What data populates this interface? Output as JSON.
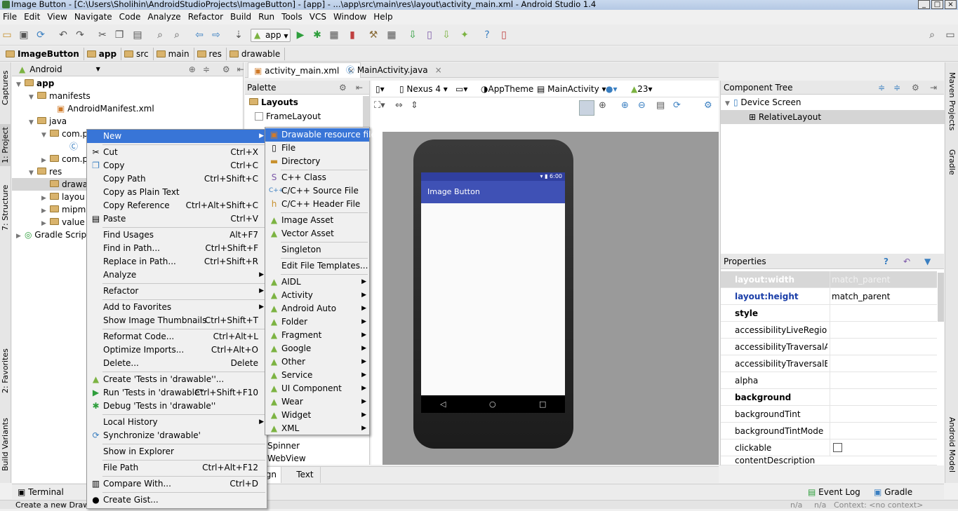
{
  "title": "Image Button - [C:\\Users\\Sholihin\\AndroidStudioProjects\\ImageButton] - [app] - ...\\app\\src\\main\\res\\layout\\activity_main.xml - Android Studio 1.4",
  "menubar": [
    "File",
    "Edit",
    "View",
    "Navigate",
    "Code",
    "Analyze",
    "Refactor",
    "Build",
    "Run",
    "Tools",
    "VCS",
    "Window",
    "Help"
  ],
  "toolbar": {
    "run_config": "app"
  },
  "breadcrumbs": [
    "ImageButton",
    "app",
    "src",
    "main",
    "res",
    "drawable"
  ],
  "left_tabs": [
    "1: Project",
    "7: Structure",
    "Captures",
    "2: Favorites",
    "Build Variants"
  ],
  "right_tabs": [
    "Maven Projects",
    "Gradle",
    "Android Model"
  ],
  "project": {
    "view": "Android",
    "tree": [
      "app",
      "manifests",
      "AndroidManifest.xml",
      "java",
      "com.p",
      "com.p",
      "res",
      "drawa",
      "layou",
      "mipma",
      "value",
      "Gradle Scripts"
    ]
  },
  "editor_tabs": [
    "activity_main.xml",
    "MainActivity.java"
  ],
  "palette": {
    "title": "Palette",
    "section": "Layouts",
    "items": [
      "FrameLayout",
      "Spinner",
      "WebView"
    ]
  },
  "design_toolbar": {
    "device": "Nexus 4",
    "theme": "AppTheme",
    "activity": "MainActivity",
    "api": "23"
  },
  "device": {
    "time": "6:00",
    "app_title": "Image Button"
  },
  "design_tabs": [
    "Design",
    "Text"
  ],
  "component_tree": {
    "title": "Component Tree",
    "items": [
      "Device Screen",
      "RelativeLayout"
    ]
  },
  "properties": {
    "title": "Properties",
    "rows": [
      {
        "k": "layout:width",
        "v": "match_parent"
      },
      {
        "k": "layout:height",
        "v": "match_parent"
      },
      {
        "k": "style",
        "v": ""
      },
      {
        "k": "accessibilityLiveRegion",
        "v": ""
      },
      {
        "k": "accessibilityTraversalAfter",
        "v": ""
      },
      {
        "k": "accessibilityTraversalBefore",
        "v": ""
      },
      {
        "k": "alpha",
        "v": ""
      },
      {
        "k": "background",
        "v": ""
      },
      {
        "k": "backgroundTint",
        "v": ""
      },
      {
        "k": "backgroundTintMode",
        "v": ""
      },
      {
        "k": "clickable",
        "v": ""
      },
      {
        "k": "contentDescription",
        "v": ""
      }
    ]
  },
  "context_menu": [
    {
      "label": "New",
      "shortcut": "",
      "submenu": true
    },
    {
      "label": "Cut",
      "shortcut": "Ctrl+X"
    },
    {
      "label": "Copy",
      "shortcut": "Ctrl+C"
    },
    {
      "label": "Copy Path",
      "shortcut": "Ctrl+Shift+C"
    },
    {
      "label": "Copy as Plain Text",
      "shortcut": ""
    },
    {
      "label": "Copy Reference",
      "shortcut": "Ctrl+Alt+Shift+C"
    },
    {
      "label": "Paste",
      "shortcut": "Ctrl+V"
    },
    {
      "label": "Find Usages",
      "shortcut": "Alt+F7"
    },
    {
      "label": "Find in Path...",
      "shortcut": "Ctrl+Shift+F"
    },
    {
      "label": "Replace in Path...",
      "shortcut": "Ctrl+Shift+R"
    },
    {
      "label": "Analyze",
      "shortcut": "",
      "submenu": true
    },
    {
      "label": "Refactor",
      "shortcut": "",
      "submenu": true
    },
    {
      "label": "Add to Favorites",
      "shortcut": "",
      "submenu": true
    },
    {
      "label": "Show Image Thumbnails",
      "shortcut": "Ctrl+Shift+T"
    },
    {
      "label": "Reformat Code...",
      "shortcut": "Ctrl+Alt+L"
    },
    {
      "label": "Optimize Imports...",
      "shortcut": "Ctrl+Alt+O"
    },
    {
      "label": "Delete...",
      "shortcut": "Delete"
    },
    {
      "label": "Create 'Tests in 'drawable''...",
      "shortcut": ""
    },
    {
      "label": "Run 'Tests in 'drawable''",
      "shortcut": "Ctrl+Shift+F10"
    },
    {
      "label": "Debug 'Tests in 'drawable''",
      "shortcut": ""
    },
    {
      "label": "Local History",
      "shortcut": "",
      "submenu": true
    },
    {
      "label": "Synchronize 'drawable'",
      "shortcut": ""
    },
    {
      "label": "Show in Explorer",
      "shortcut": ""
    },
    {
      "label": "File Path",
      "shortcut": "Ctrl+Alt+F12"
    },
    {
      "label": "Compare With...",
      "shortcut": "Ctrl+D"
    },
    {
      "label": "Create Gist...",
      "shortcut": ""
    }
  ],
  "new_submenu": [
    "Drawable resource file",
    "File",
    "Directory",
    "C++ Class",
    "C/C++ Source File",
    "C/C++ Header File",
    "Image Asset",
    "Vector Asset",
    "Singleton",
    "Edit File Templates...",
    "AIDL",
    "Activity",
    "Android Auto",
    "Folder",
    "Fragment",
    "Google",
    "Other",
    "Service",
    "UI Component",
    "Wear",
    "Widget",
    "XML"
  ],
  "bottom_tabs": [
    "Terminal",
    "Event Log",
    "Gradle Console"
  ],
  "status": {
    "left": "Create a new Drawa",
    "right1": "n/a",
    "right2": "n/a",
    "context": "Context: <no context>"
  }
}
